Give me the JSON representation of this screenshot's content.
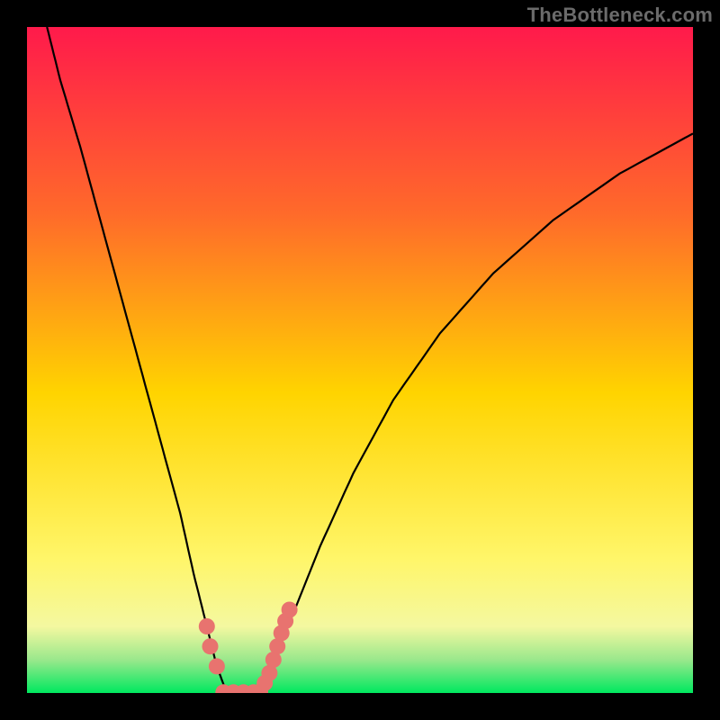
{
  "watermark": "TheBottleneck.com",
  "colors": {
    "frame": "#000000",
    "gradient_top": "#ff1a4b",
    "gradient_mid_upper": "#ff7a2a",
    "gradient_mid": "#ffd400",
    "gradient_lower": "#f7f77a",
    "gradient_bottom": "#00e85f",
    "curve": "#000000",
    "marker_fill": "#e8736f",
    "marker_stroke": "#e8736f"
  },
  "chart_data": {
    "type": "line",
    "title": "",
    "xlabel": "",
    "ylabel": "",
    "xlim": [
      0,
      100
    ],
    "ylim": [
      0,
      100
    ],
    "series": [
      {
        "name": "left-curve",
        "x": [
          3,
          5,
          8,
          11,
          14,
          17,
          20,
          23,
          25,
          27,
          28.5,
          30
        ],
        "y": [
          100,
          92,
          82,
          71,
          60,
          49,
          38,
          27,
          18,
          10,
          4,
          0
        ]
      },
      {
        "name": "right-curve",
        "x": [
          35,
          37,
          40,
          44,
          49,
          55,
          62,
          70,
          79,
          89,
          100
        ],
        "y": [
          0,
          5,
          12,
          22,
          33,
          44,
          54,
          63,
          71,
          78,
          84
        ]
      }
    ],
    "valley_markers": {
      "left": {
        "x": [
          27.0,
          27.5,
          28.5
        ],
        "y": [
          10,
          7,
          4
        ]
      },
      "right": {
        "x": [
          35.0,
          35.7,
          36.4,
          37.0,
          37.6,
          38.2,
          38.8,
          39.4
        ],
        "y": [
          0.2,
          1.5,
          3.0,
          5.0,
          7.0,
          9.0,
          10.8,
          12.5
        ]
      },
      "floor": {
        "x": [
          29.5,
          31.0,
          32.5,
          34.0
        ],
        "y": [
          0.1,
          0.1,
          0.1,
          0.1
        ]
      }
    }
  }
}
